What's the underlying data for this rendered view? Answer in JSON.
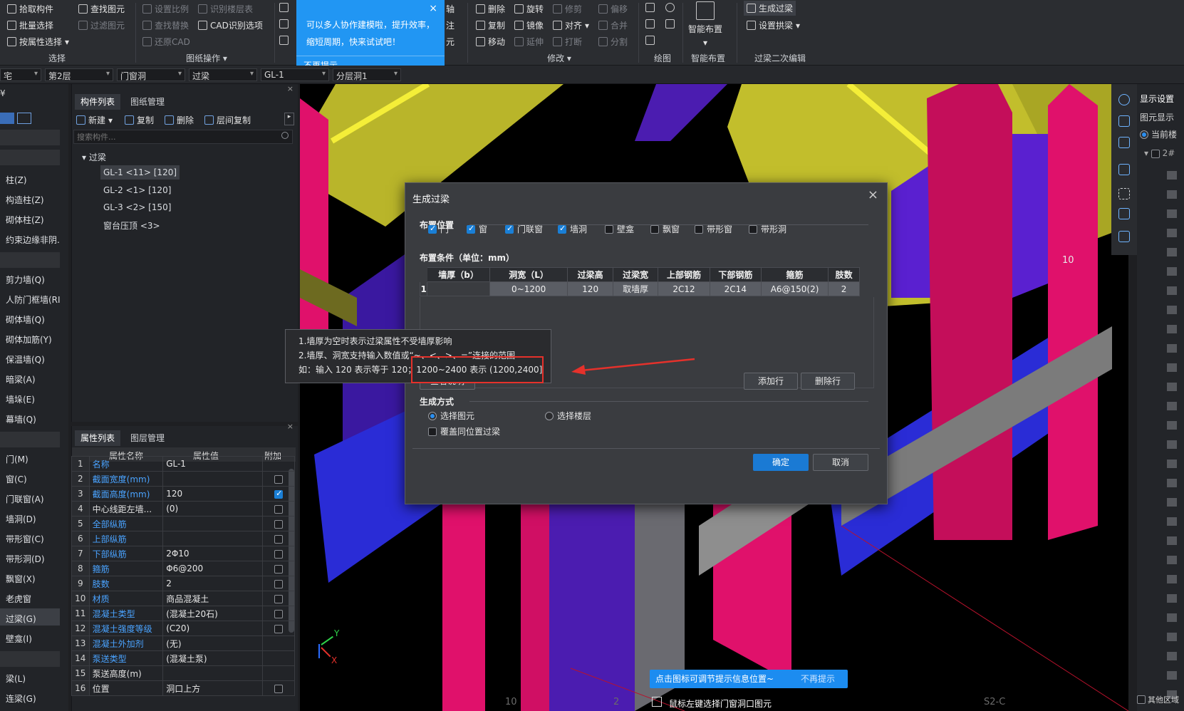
{
  "ribbon": {
    "select_group": {
      "label": "选择",
      "items": [
        "拾取构件",
        "批量选择",
        "按属性选择"
      ]
    },
    "find_group": {
      "items": [
        "查找图元",
        "过滤图元"
      ]
    },
    "drawing_group": {
      "label": "图纸操作",
      "items": [
        "设置比例",
        "识别楼层表",
        "查找替换",
        "CAD识别选项",
        "还原CAD"
      ]
    },
    "modify_group": {
      "label": "修改",
      "items": [
        "删除",
        "旋转",
        "修剪",
        "偏移",
        "复制",
        "镜像",
        "对齐",
        "合并",
        "移动",
        "延伸",
        "打断",
        "分割"
      ]
    },
    "draw_group": {
      "label": "绘图"
    },
    "smart_group": {
      "label": "智能布置",
      "button": "智能布置"
    },
    "lintel_group": {
      "label": "过梁二次编辑",
      "items": [
        "生成过梁",
        "设置拱梁"
      ]
    },
    "partial_labels": [
      "轴",
      "注",
      "元"
    ]
  },
  "promo": {
    "line1": "可以多人协作建模啦，提升效率，",
    "line2": "缩短周期，快来试试吧！",
    "dismiss": "不再提示",
    "close": "×"
  },
  "combo_row": {
    "building": "宅",
    "floor": "第2层",
    "category": "门窗洞",
    "type": "过梁",
    "component": "GL-1",
    "layer": "分层洞1"
  },
  "left_sidebar": {
    "header_partial": "¥",
    "items_a": [
      "柱(Z)",
      "构造柱(Z)",
      "砌体柱(Z)",
      "约束边缘非阴."
    ],
    "items_b": [
      "剪力墙(Q)",
      "人防门框墙(RI",
      "砌体墙(Q)",
      "砌体加筋(Y)",
      "保温墙(Q)",
      "暗梁(A)",
      "墙垛(E)",
      "幕墙(Q)"
    ],
    "items_c": [
      "门(M)",
      "窗(C)",
      "门联窗(A)",
      "墙洞(D)",
      "带形窗(C)",
      "带形洞(D)",
      "飘窗(X)",
      "老虎窗",
      "过梁(G)",
      "壁龛(I)"
    ],
    "items_d": [
      "梁(L)",
      "连梁(G)"
    ]
  },
  "component_panel": {
    "tabs": [
      "构件列表",
      "图纸管理"
    ],
    "actions": [
      "新建",
      "复制",
      "删除",
      "层间复制"
    ],
    "search_placeholder": "搜索构件...",
    "tree_root": "过梁",
    "tree_items": [
      "GL-1 <11> [120]",
      "GL-2 <1> [120]",
      "GL-3 <2> [150]",
      "窗台压顶 <3>"
    ]
  },
  "property_panel": {
    "tabs": [
      "属性列表",
      "图层管理"
    ],
    "headers": [
      "属性名称",
      "属性值",
      "附加"
    ],
    "rows": [
      {
        "n": "1",
        "name": "名称",
        "value": "GL-1",
        "blue": true,
        "check": "none"
      },
      {
        "n": "2",
        "name": "截面宽度(mm)",
        "value": "",
        "blue": true,
        "check": "off"
      },
      {
        "n": "3",
        "name": "截面高度(mm)",
        "value": "120",
        "blue": true,
        "check": "on"
      },
      {
        "n": "4",
        "name": "中心线距左墙...",
        "value": "(0)",
        "blue": false,
        "check": "off"
      },
      {
        "n": "5",
        "name": "全部纵筋",
        "value": "",
        "blue": true,
        "check": "off"
      },
      {
        "n": "6",
        "name": "上部纵筋",
        "value": "",
        "blue": true,
        "check": "off"
      },
      {
        "n": "7",
        "name": "下部纵筋",
        "value": "2Φ10",
        "blue": true,
        "check": "off"
      },
      {
        "n": "8",
        "name": "箍筋",
        "value": "Φ6@200",
        "blue": true,
        "check": "off"
      },
      {
        "n": "9",
        "name": "肢数",
        "value": "2",
        "blue": true,
        "check": "off"
      },
      {
        "n": "10",
        "name": "材质",
        "value": "商品混凝土",
        "blue": true,
        "check": "off"
      },
      {
        "n": "11",
        "name": "混凝土类型",
        "value": "(混凝土20石)",
        "blue": true,
        "check": "off"
      },
      {
        "n": "12",
        "name": "混凝土强度等级",
        "value": "(C20)",
        "blue": true,
        "check": "off"
      },
      {
        "n": "13",
        "name": "混凝土外加剂",
        "value": "(无)",
        "blue": true,
        "check": "none"
      },
      {
        "n": "14",
        "name": "泵送类型",
        "value": "(混凝土泵)",
        "blue": true,
        "check": "none"
      },
      {
        "n": "15",
        "name": "泵送高度(m)",
        "value": "",
        "blue": false,
        "check": "none"
      },
      {
        "n": "16",
        "name": "位置",
        "value": "洞口上方",
        "blue": false,
        "check": "off"
      }
    ]
  },
  "dialog": {
    "title": "生成过梁",
    "close": "×",
    "placement_label": "布置位置",
    "placement_options": [
      {
        "label": "门",
        "checked": true
      },
      {
        "label": "窗",
        "checked": true
      },
      {
        "label": "门联窗",
        "checked": true
      },
      {
        "label": "墙洞",
        "checked": true
      },
      {
        "label": "壁龛",
        "checked": false
      },
      {
        "label": "飘窗",
        "checked": false
      },
      {
        "label": "带形窗",
        "checked": false
      },
      {
        "label": "带形洞",
        "checked": false
      }
    ],
    "condition_label": "布置条件（单位：mm）",
    "table_headers": [
      "墙厚（b）",
      "洞宽（L）",
      "过梁高",
      "过梁宽",
      "上部钢筋",
      "下部钢筋",
      "箍筋",
      "肢数"
    ],
    "table_row": {
      "idx": "1",
      "cells": [
        "",
        "0~1200",
        "120",
        "取墙厚",
        "2C12",
        "2C14",
        "A6@150(2)",
        "2"
      ]
    },
    "view_help": "查看说明",
    "add_row": "添加行",
    "delete_row": "删除行",
    "gen_mode_label": "生成方式",
    "mode_options": [
      {
        "label": "选择图元",
        "selected": true
      },
      {
        "label": "选择楼层",
        "selected": false
      }
    ],
    "overwrite_label": "覆盖同位置过梁",
    "ok": "确定",
    "cancel": "取消"
  },
  "tooltip": {
    "line1": "1.墙厚为空时表示过梁属性不受墙厚影响",
    "line2": "2.墙厚、洞宽支持输入数值或“~、<、>、=”连接的范围",
    "line3a": "如：输入 120 表示等于 120；",
    "line3b": "1200~2400 表示 (1200,2400]"
  },
  "right_panel": {
    "title": "显示设置",
    "sub": "图元显示",
    "radio_label": "当前楼",
    "tree_partial": "2#",
    "bottom_check": "其他区域"
  },
  "viewport": {
    "label_10_right": "10",
    "label_10_bottom": "10",
    "label_s2c": "S2-C",
    "label_2": "2",
    "axis_x": "X",
    "axis_y": "Y",
    "status_text": "鼠标左键选择门窗洞口图元"
  },
  "hint": {
    "text": "点击图标可调节提示信息位置~",
    "dismiss": "不再提示"
  },
  "colors": {
    "accent": "#2196f3",
    "yellow": "#c9c531",
    "magenta": "#e0116b",
    "purple": "#5a1fd1",
    "blue": "#2a2cd6",
    "gray": "#7b7b7b",
    "highlight_red": "#e5312b"
  }
}
